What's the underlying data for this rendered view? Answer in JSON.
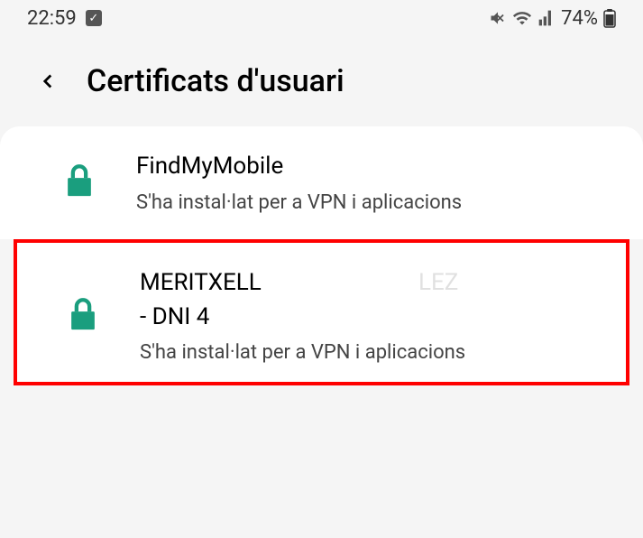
{
  "statusBar": {
    "time": "22:59",
    "batteryText": "74%"
  },
  "header": {
    "title": "Certificats d'usuari"
  },
  "certificates": [
    {
      "title": "FindMyMobile",
      "subtitle": "S'ha instal·lat per a VPN i aplicacions"
    },
    {
      "titleLine1": "MERITXELL",
      "titleLine1Redacted": "LEZ",
      "titleLine2": "- DNI 4",
      "subtitle": "S'ha instal·lat per a VPN i aplicacions"
    }
  ]
}
